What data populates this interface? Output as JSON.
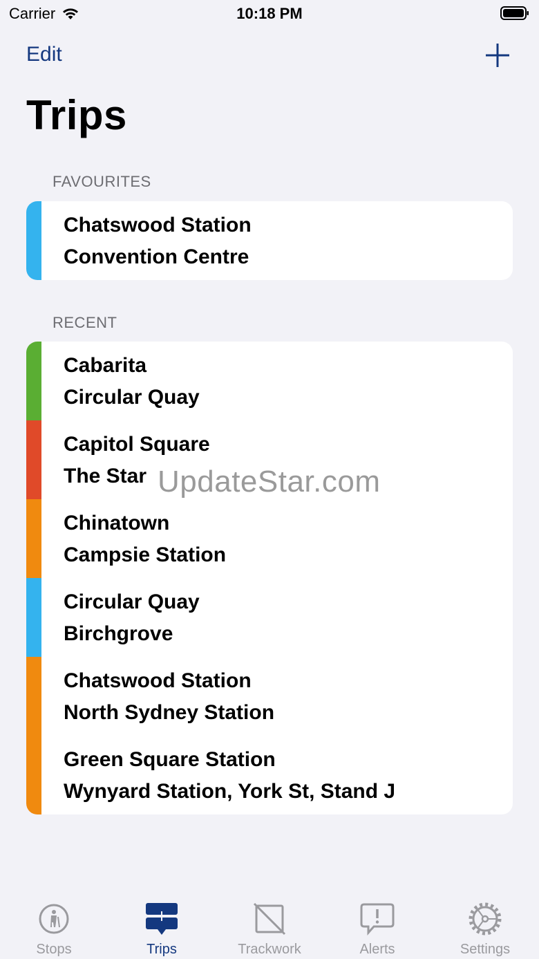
{
  "status_bar": {
    "carrier": "Carrier",
    "time": "10:18 PM"
  },
  "nav": {
    "edit_label": "Edit",
    "add_icon": "plus-icon"
  },
  "title": "Trips",
  "favourites": {
    "header": "FAVOURITES",
    "items": [
      {
        "from": "Chatswood Station",
        "to": "Convention Centre",
        "color": "#34b3ee"
      }
    ]
  },
  "recent": {
    "header": "RECENT",
    "items": [
      {
        "from": "Cabarita",
        "to": "Circular Quay",
        "color": "#5aae33"
      },
      {
        "from": "Capitol Square",
        "to": "The Star",
        "color": "#e04a29"
      },
      {
        "from": "Chinatown",
        "to": "Campsie Station",
        "color": "#f08a0f"
      },
      {
        "from": "Circular Quay",
        "to": "Birchgrove",
        "color": "#34b3ee"
      },
      {
        "from": "Chatswood Station",
        "to": "North Sydney Station",
        "color": "#f08a0f"
      },
      {
        "from": "Green Square Station",
        "to": "Wynyard Station, York St, Stand J",
        "color": "#f08a0f"
      }
    ]
  },
  "watermark": "UpdateStar.com",
  "tabs": [
    {
      "label": "Stops",
      "icon": "person-icon",
      "active": false
    },
    {
      "label": "Trips",
      "icon": "trips-icon",
      "active": true
    },
    {
      "label": "Trackwork",
      "icon": "trackwork-icon",
      "active": false
    },
    {
      "label": "Alerts",
      "icon": "alert-bubble-icon",
      "active": false
    },
    {
      "label": "Settings",
      "icon": "gear-icon",
      "active": false
    }
  ],
  "colors": {
    "accent": "#14387f",
    "inactive": "#9a9a9e",
    "background": "#f2f2f7"
  }
}
